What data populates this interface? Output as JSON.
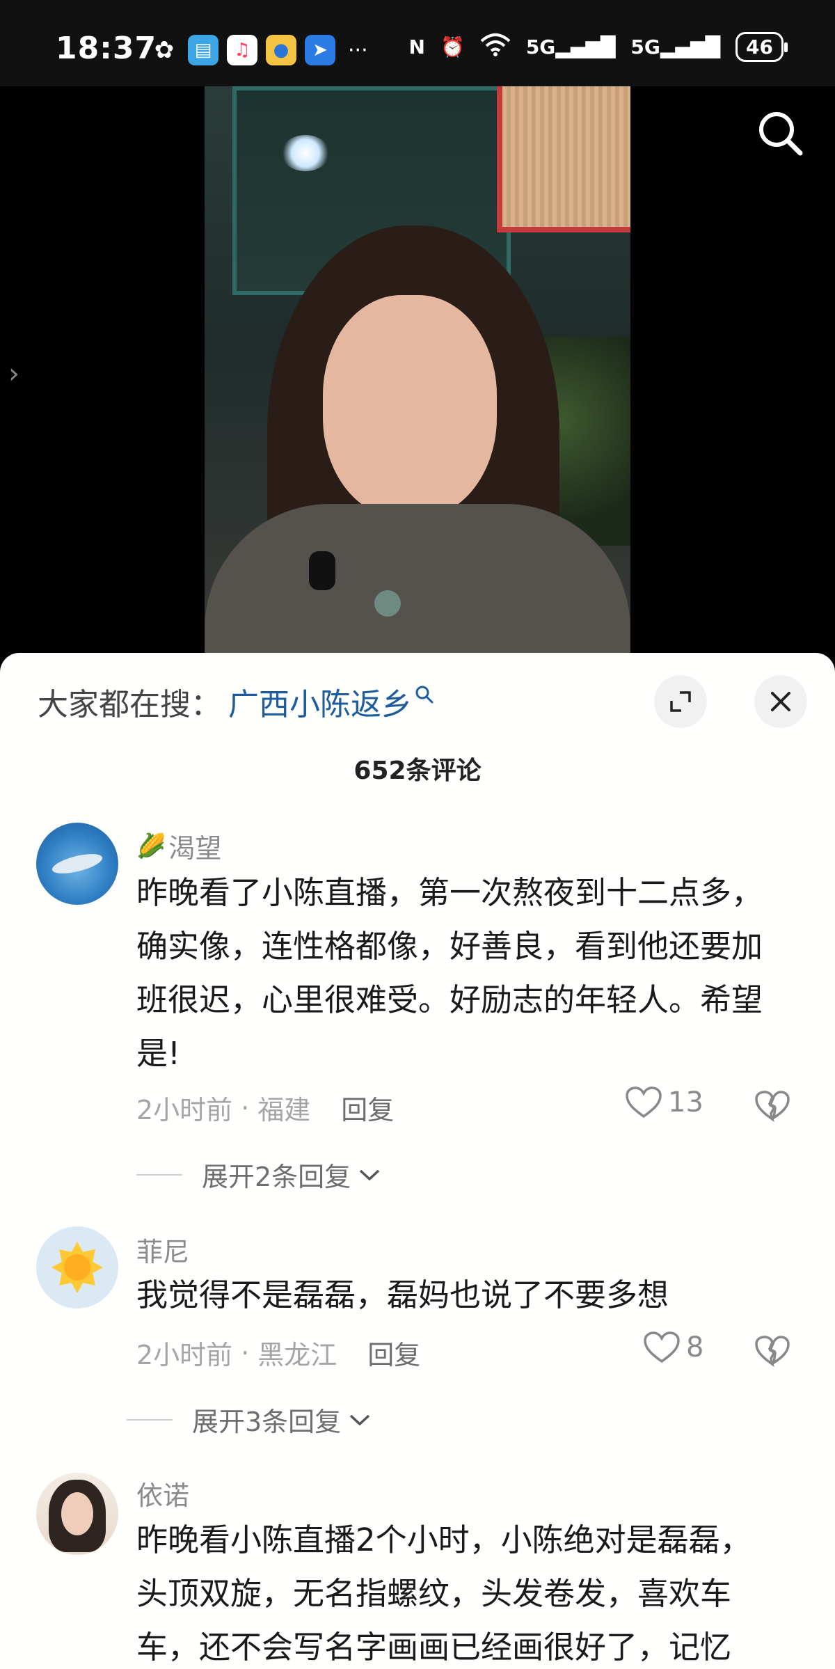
{
  "status_bar": {
    "time": "18:37",
    "app_icons": [
      "wechat-icon",
      "book-icon",
      "music-icon",
      "browser-icon",
      "nav-icon"
    ],
    "more": "···",
    "nfc": "N",
    "network1": "5G",
    "network2": "5G",
    "battery": "46"
  },
  "video": {
    "side_arrow": "›"
  },
  "sheet": {
    "search_prefix": "大家都在搜：",
    "search_term": "广西小陈返乡",
    "comment_count": "652条评论"
  },
  "comments": [
    {
      "username": "渴望",
      "badge": "🌽",
      "text": "昨晚看了小陈直播，第一次熬夜到十二点多，确实像，连性格都像，好善良，看到他还要加班很迟，心里很难受。好励志的年轻人。希望是!",
      "time": "2小时前",
      "separator": "·",
      "location": "福建",
      "reply_label": "回复",
      "likes": "13",
      "expand_label": "展开2条回复"
    },
    {
      "username": "菲尼",
      "text": "我觉得不是磊磊，磊妈也说了不要多想",
      "time": "2小时前",
      "separator": "·",
      "location": "黑龙江",
      "reply_label": "回复",
      "likes": "8",
      "expand_label": "展开3条回复"
    },
    {
      "username": "依诺",
      "text": "昨晚看小陈直播2个小时，小陈绝对是磊磊，头顶双旋，无名指螺纹，头发卷发，喜欢车车，还不会写名字画画已经画很好了，记忆"
    }
  ]
}
